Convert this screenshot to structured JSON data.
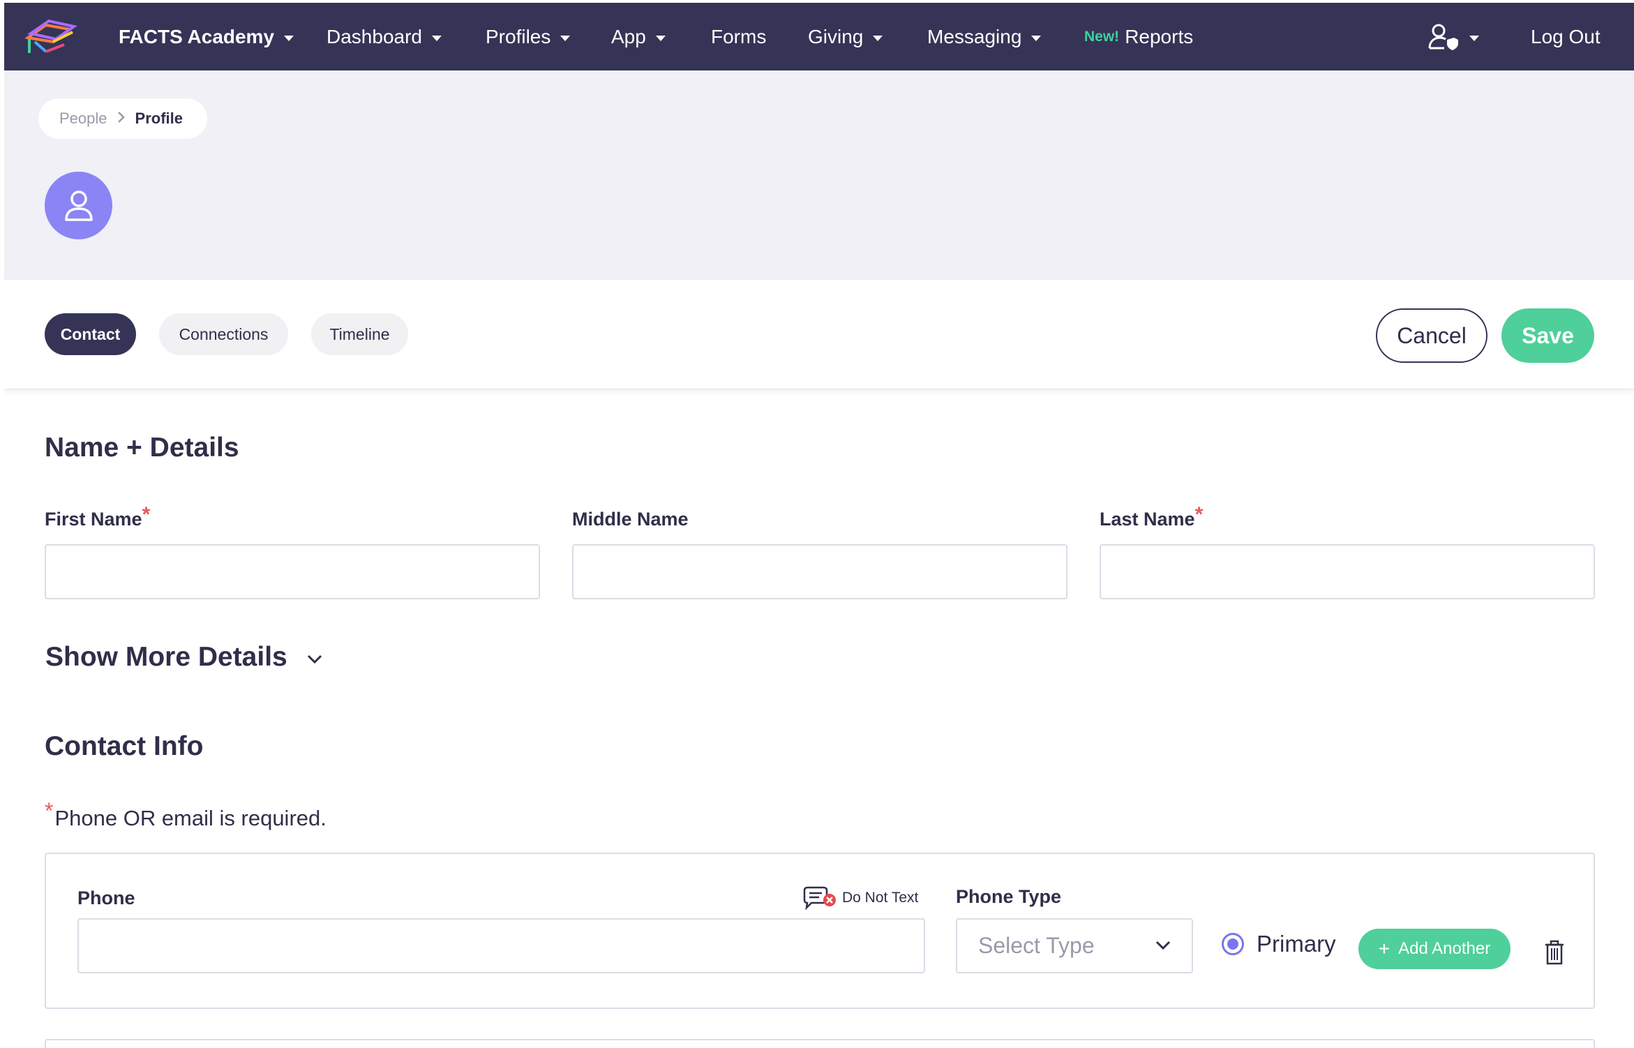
{
  "nav": {
    "brand": "FACTS Academy",
    "items": [
      {
        "label": "Dashboard",
        "dropdown": true
      },
      {
        "label": "Profiles",
        "dropdown": true
      },
      {
        "label": "App",
        "dropdown": true
      },
      {
        "label": "Forms",
        "dropdown": false
      },
      {
        "label": "Giving",
        "dropdown": true
      },
      {
        "label": "Messaging",
        "dropdown": true
      }
    ],
    "reports_badge": "New!",
    "reports_label": "Reports",
    "logout_label": "Log Out"
  },
  "breadcrumb": {
    "parent": "People",
    "current": "Profile"
  },
  "tabs": [
    {
      "label": "Contact",
      "active": true
    },
    {
      "label": "Connections",
      "active": false
    },
    {
      "label": "Timeline",
      "active": false
    }
  ],
  "actions": {
    "cancel": "Cancel",
    "save": "Save"
  },
  "name_section": {
    "title": "Name + Details",
    "first_name_label": "First Name",
    "middle_name_label": "Middle Name",
    "last_name_label": "Last Name",
    "required_mark": "*",
    "show_more": "Show More Details"
  },
  "contact_section": {
    "title": "Contact Info",
    "required_note_star": "*",
    "required_note": "Phone OR email is required.",
    "phone_label": "Phone",
    "do_not_text": "Do Not Text",
    "phone_type_label": "Phone Type",
    "phone_type_placeholder": "Select Type",
    "primary_label": "Primary",
    "add_another": "Add Another"
  },
  "colors": {
    "navbar": "#353456",
    "accent_green": "#4fcf9a",
    "accent_purple": "#8b84f5",
    "required_red": "#e85a5a",
    "header_bg": "#f0f0f6"
  },
  "icons": [
    "logo-icon",
    "user-shield-icon",
    "user-avatar-icon",
    "chevron-right-icon",
    "chevron-down-icon",
    "no-text-message-icon",
    "trash-icon",
    "plus-icon"
  ]
}
